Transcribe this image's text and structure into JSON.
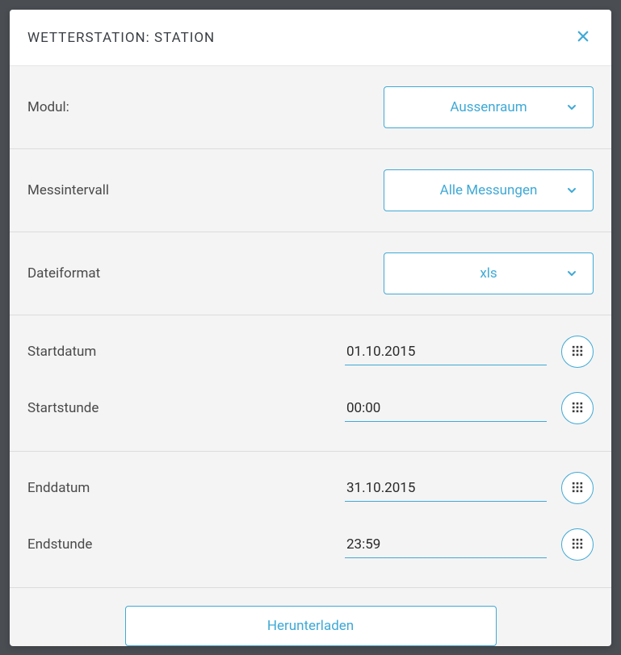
{
  "modal": {
    "title": "WETTERSTATION: STATION"
  },
  "fields": {
    "module": {
      "label": "Modul:",
      "value": "Aussenraum"
    },
    "interval": {
      "label": "Messintervall",
      "value": "Alle Messungen"
    },
    "format": {
      "label": "Dateiformat",
      "value": "xls"
    },
    "startDate": {
      "label": "Startdatum",
      "value": "01.10.2015"
    },
    "startTime": {
      "label": "Startstunde",
      "value": "00:00"
    },
    "endDate": {
      "label": "Enddatum",
      "value": "31.10.2015"
    },
    "endTime": {
      "label": "Endstunde",
      "value": "23:59"
    }
  },
  "actions": {
    "download": "Herunterladen"
  }
}
